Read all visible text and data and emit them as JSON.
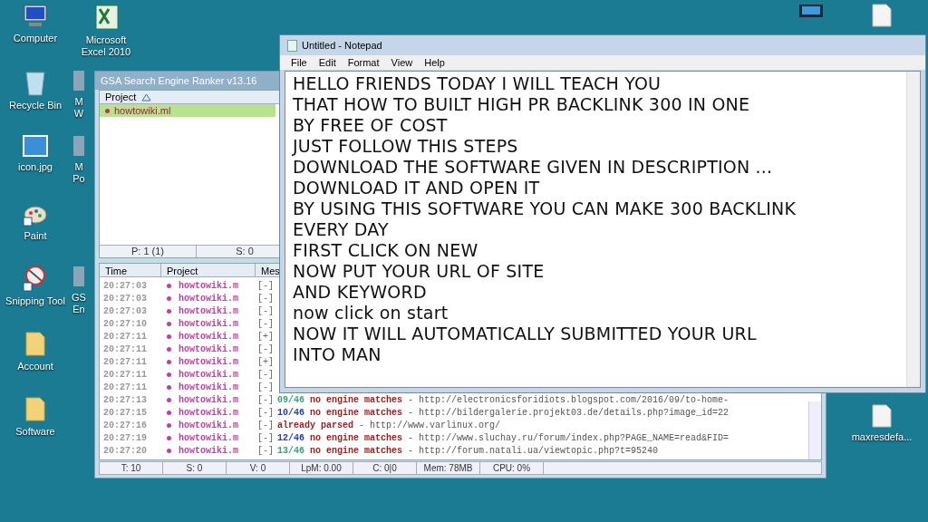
{
  "desktop_icons": [
    {
      "kind": "computer",
      "lines": [
        "Computer"
      ]
    },
    {
      "kind": "recycle",
      "lines": [
        "Recycle Bin"
      ]
    },
    {
      "kind": "image",
      "lines": [
        "icon.jpg"
      ]
    },
    {
      "kind": "paint",
      "lines": [
        "Paint"
      ]
    },
    {
      "kind": "snip",
      "lines": [
        "Snipping Tool"
      ]
    },
    {
      "kind": "folder",
      "lines": [
        "Account"
      ]
    },
    {
      "kind": "folder",
      "lines": [
        "Software"
      ]
    }
  ],
  "desktop_icons_second_column": [
    {
      "kind": "excel",
      "lines": [
        "Microsoft",
        "Excel 2010"
      ]
    },
    {
      "kind": "app",
      "lines": [
        "M",
        "W"
      ]
    },
    {
      "kind": "app",
      "lines": [
        "M",
        "Po"
      ]
    },
    {
      "kind": "app",
      "lines": [
        "GS",
        "En"
      ]
    }
  ],
  "right_top_icons": [
    {
      "kind": "monitor"
    },
    {
      "kind": "file"
    }
  ],
  "right_bottom_icons": [
    {
      "kind": "file",
      "lines": [
        "maxresdefa..."
      ]
    }
  ],
  "gsa": {
    "title": "GSA Search Engine Ranker v13.16",
    "project_header": "Project",
    "projects": [
      {
        "name": "howtowiki.ml",
        "selected": true
      }
    ],
    "project_footer": [
      "P: 1 (1)",
      "S: 0"
    ],
    "log_columns": [
      "Time",
      "Project",
      "Mes"
    ],
    "log_rows": [
      {
        "time": "20:27:03",
        "project": "howtowiki.m",
        "status": "[-]"
      },
      {
        "time": "20:27:03",
        "project": "howtowiki.m",
        "status": "[-]"
      },
      {
        "time": "20:27:03",
        "project": "howtowiki.m",
        "status": "[-]"
      },
      {
        "time": "20:27:10",
        "project": "howtowiki.m",
        "status": "[-]"
      },
      {
        "time": "20:27:11",
        "project": "howtowiki.m",
        "status": "[+]"
      },
      {
        "time": "20:27:11",
        "project": "howtowiki.m",
        "status": "[-]"
      },
      {
        "time": "20:27:11",
        "project": "howtowiki.m",
        "status": "[+]"
      },
      {
        "time": "20:27:11",
        "project": "howtowiki.m",
        "status": "[-]"
      },
      {
        "time": "20:27:11",
        "project": "howtowiki.m",
        "status": "[-]"
      },
      {
        "time": "20:27:13",
        "project": "howtowiki.m",
        "status": "[-]",
        "count": "09/46",
        "message": "no engine matches",
        "url": "- http://electronicsforidiots.blogspot.com/2016/09/to-home-",
        "color": "#3aa07a"
      },
      {
        "time": "20:27:15",
        "project": "howtowiki.m",
        "status": "[-]",
        "count": "10/46",
        "message": "no engine matches",
        "url": "- http://bildergalerie.projekt03.de/details.php?image_id=22",
        "color": "#2a3bb0"
      },
      {
        "time": "20:27:16",
        "project": "howtowiki.m",
        "status": "[-]",
        "message": "already parsed",
        "url": "- http://www.varlinux.org/"
      },
      {
        "time": "20:27:19",
        "project": "howtowiki.m",
        "status": "[-]",
        "count": "12/46",
        "message": "no engine matches",
        "url": "- http://www.sluchay.ru/forum/index.php?PAGE_NAME=read&FID=",
        "color": "#2a3bb0"
      },
      {
        "time": "20:27:20",
        "project": "howtowiki.m",
        "status": "[-]",
        "count": "13/46",
        "message": "no engine matches",
        "url": "- http://forum.natali.ua/viewtopic.php?t=95240",
        "color": "#3aa07a"
      }
    ],
    "status_bar": [
      "T: 10",
      "S: 0",
      "V: 0",
      "LpM: 0.00",
      "C: 0|0",
      "Mem: 78MB",
      "CPU: 0%"
    ]
  },
  "notepad": {
    "title": "Untitled - Notepad",
    "menu": [
      "File",
      "Edit",
      "Format",
      "View",
      "Help"
    ],
    "lines": [
      "HELLO FRIENDS TODAY I WILL TEACH YOU",
      "THAT HOW TO BUILT HIGH PR BACKLINK 300 IN ONE",
      "BY FREE OF COST",
      "JUST FOLLOW THIS STEPS",
      "DOWNLOAD THE SOFTWARE GIVEN IN DESCRIPTION ...",
      "DOWNLOAD IT AND OPEN IT",
      "BY USING THIS SOFTWARE YOU CAN MAKE 300 BACKLINK",
      "EVERY DAY",
      "FIRST CLICK ON NEW",
      "NOW PUT YOUR URL OF SITE",
      "AND KEYWORD",
      "now click on start",
      "NOW IT WILL AUTOMATICALLY SUBMITTED YOUR URL",
      "INTO MAN"
    ]
  }
}
